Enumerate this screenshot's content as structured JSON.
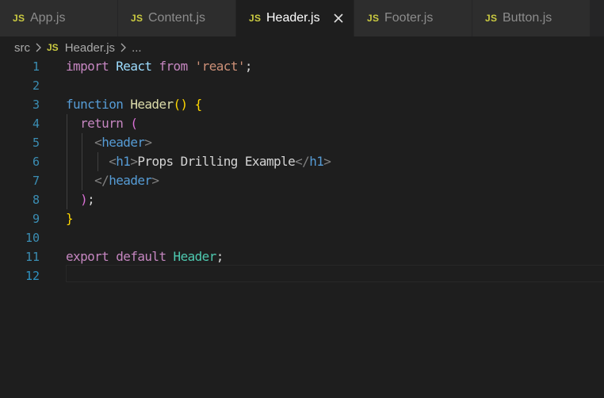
{
  "tabs": [
    {
      "icon": "JS",
      "label": "App.js",
      "active": false
    },
    {
      "icon": "JS",
      "label": "Content.js",
      "active": false
    },
    {
      "icon": "JS",
      "label": "Header.js",
      "active": true
    },
    {
      "icon": "JS",
      "label": "Footer.js",
      "active": false
    },
    {
      "icon": "JS",
      "label": "Button.js",
      "active": false
    }
  ],
  "breadcrumb": {
    "folder": "src",
    "file_icon": "JS",
    "file": "Header.js",
    "symbol": "..."
  },
  "line_numbers": [
    "1",
    "2",
    "3",
    "4",
    "5",
    "6",
    "7",
    "8",
    "9",
    "10",
    "11",
    "12"
  ],
  "code": {
    "l1": {
      "kw": "import",
      "name": "React",
      "from": "from",
      "str": "'react'",
      "end": ";"
    },
    "l3": {
      "kw": "function",
      "name": "Header",
      "parens": "()",
      "brace": "{"
    },
    "l4": {
      "kw": "return",
      "paren": "("
    },
    "l5": {
      "open": "<",
      "tag": "header",
      "close": ">"
    },
    "l6": {
      "open": "<",
      "tag": "h1",
      "close": ">",
      "text": "Props Drilling Example",
      "end_open": "</",
      "end_tag": "h1",
      "end_close": ">"
    },
    "l7": {
      "open": "</",
      "tag": "header",
      "close": ">"
    },
    "l8": {
      "paren": ")",
      "semi": ";"
    },
    "l9": {
      "brace": "}"
    },
    "l11": {
      "kw1": "export",
      "kw2": "default",
      "name": "Header",
      "semi": ";"
    }
  },
  "colors": {
    "background": "#1e1e1e",
    "tab_inactive": "#2d2d2d",
    "js_icon": "#cbcb41",
    "line_number": "#3b8eb4"
  },
  "icons": {
    "tab_close": "close-icon",
    "breadcrumb_separator": "chevron-right-icon"
  }
}
